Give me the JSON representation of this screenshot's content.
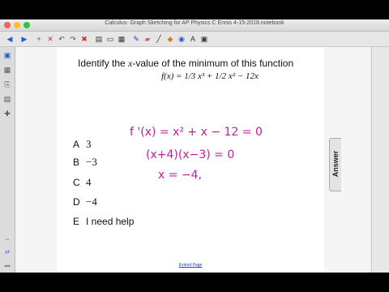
{
  "window": {
    "title": "Calculus- Graph Sketching for AP Physics C Ennis 4-15-2018.notebook"
  },
  "toolbar": {
    "icons": [
      "back-icon",
      "forward-icon",
      "add-page-icon",
      "delete-page-icon",
      "undo-icon",
      "redo-icon",
      "delete-icon",
      "screen-shade-icon",
      "display-icon",
      "table-icon",
      "pen-icon",
      "eraser-icon",
      "line-icon",
      "shape-icon",
      "fill-icon",
      "text-icon",
      "select-icon"
    ]
  },
  "page": {
    "question_prefix": "Identify the ",
    "question_var": "x",
    "question_suffix": "-value of the minimum of this function",
    "formula": "f(x) = 1/3 x³ + 1/2 x² − 12x",
    "options": [
      {
        "letter": "A",
        "value": "3"
      },
      {
        "letter": "B",
        "value": "−3"
      },
      {
        "letter": "C",
        "value": "4"
      },
      {
        "letter": "D",
        "value": "−4"
      },
      {
        "letter": "E",
        "value": "I need help"
      }
    ],
    "handwriting": [
      "f '(x) = x² + x − 12 = 0",
      "(x+4)(x−3) = 0",
      "x = −4,"
    ],
    "footer_link": "Extend Page",
    "answer_tab": "Answer"
  },
  "colors": {
    "ink": "#c71a9c"
  }
}
